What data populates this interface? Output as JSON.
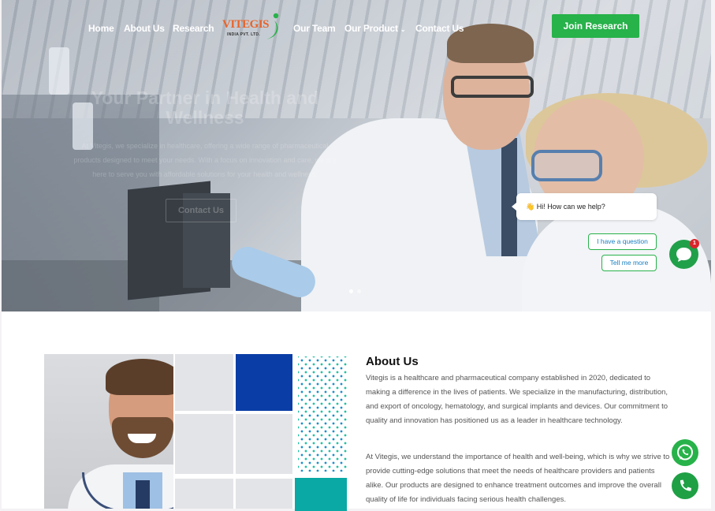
{
  "nav": {
    "items": [
      "Home",
      "About Us",
      "Research",
      "Our Team",
      "Our Product",
      "Contact Us"
    ],
    "logo_word": "VITEGIS",
    "logo_sub": "INDIA PVT. LTD.",
    "join_label": "Join Research"
  },
  "hero": {
    "title": "Your Partner in Health and Wellness",
    "description": "At Vitegis, we specialize in healthcare, offering a wide range of pharmaceutical products designed to meet your needs. With a focus on innovation and care, we are here to serve you with affordable solutions for your health and wellness.",
    "button_label": "Contact Us",
    "slides_total": 2,
    "slide_active": 1
  },
  "chat": {
    "greeting": "👋 Hi! How can we help?",
    "options": [
      "I have a question",
      "Tell me more"
    ],
    "badge_count": "1"
  },
  "about": {
    "title": "About Us",
    "paragraph1": "Vitegis is a healthcare and pharmaceutical company established in 2020, dedicated to making a difference in the lives of patients. We specialize in the manufacturing, distribution, and export of oncology, hematology, and surgical implants and devices. Our commitment to quality and innovation has positioned us as a leader in healthcare technology.",
    "paragraph2": "At Vitegis, we understand the importance of health and well-being, which is why we strive to provide cutting-edge solutions that meet the needs of healthcare providers and patients alike. Our products are designed to enhance treatment outcomes and improve the overall quality of life for individuals facing serious health challenges."
  },
  "colors": {
    "brand_green": "#27b24a",
    "brand_orange": "#e8642a",
    "accent_blue": "#0a3da6",
    "accent_teal": "#0aa9a5"
  },
  "icons": [
    "chevron-down-icon",
    "chat-icon",
    "whatsapp-icon",
    "phone-icon"
  ]
}
